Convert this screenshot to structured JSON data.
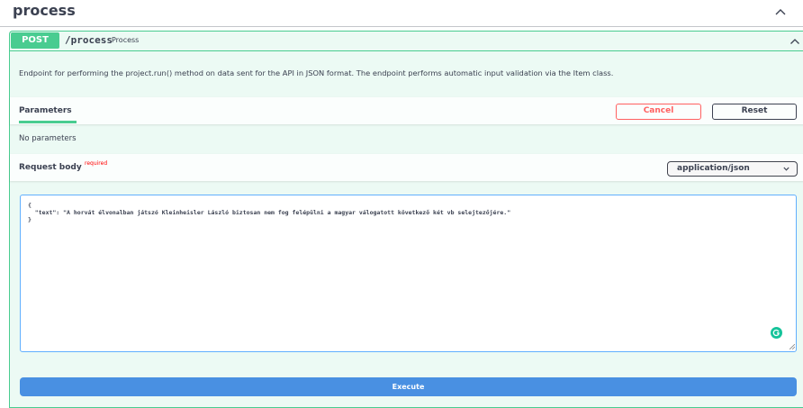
{
  "tag": {
    "title": "process"
  },
  "operation": {
    "method": "POST",
    "path": "/process",
    "summary": "Process",
    "description": "Endpoint for performing the project.run() method on data sent for the API in JSON format. The endpoint performs automatic input validation via the Item class."
  },
  "parameters": {
    "tab_label": "Parameters",
    "cancel_label": "Cancel",
    "reset_label": "Reset",
    "empty_text": "No parameters"
  },
  "request_body": {
    "label": "Request body",
    "required_label": "required",
    "content_type": "application/json",
    "value": "{\n  \"text\": \"A horvát élvonalban játszó Kleinheisler László biztosan nem fog felépülni a magyar válogatott következő két vb selejtezőjére.\"\n}"
  },
  "execute_label": "Execute",
  "colors": {
    "post": "#49cc90",
    "cancel": "#ff6060",
    "execute": "#4990e2",
    "textarea_border": "#61affe"
  },
  "icons": {
    "tag_toggle": "chevron-up-icon",
    "summary_toggle": "chevron-up-icon",
    "select": "chevron-down-icon",
    "grammarly": "grammarly-icon"
  }
}
